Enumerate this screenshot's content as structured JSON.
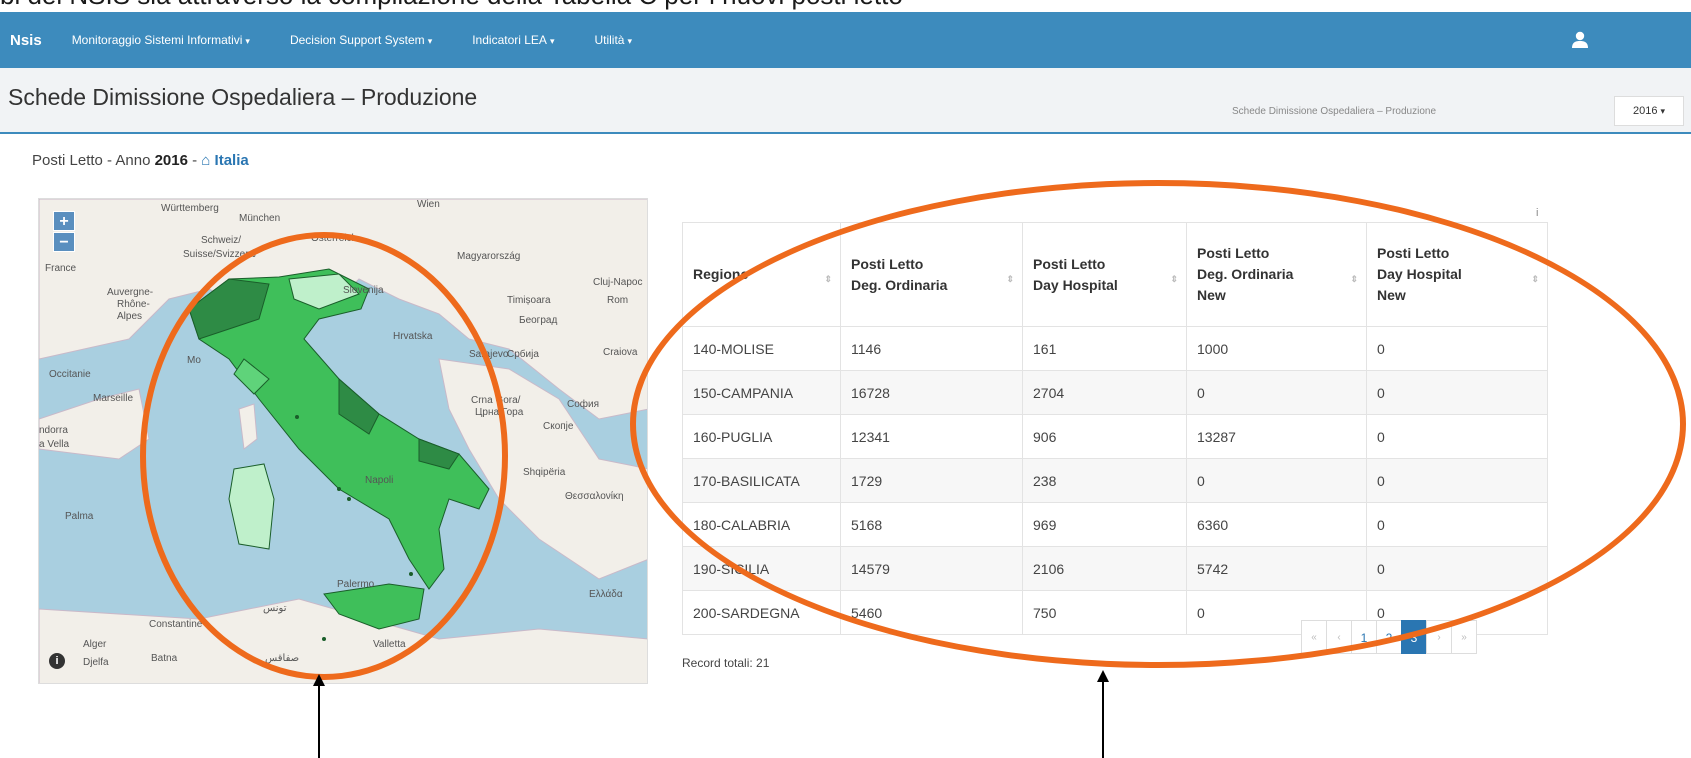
{
  "slide_caption": "bi del NSIS sia attraverso la compilazione della Tabella C per i nuovi posti letto",
  "navbar": {
    "brand": "Nsis",
    "items": [
      {
        "label": "Monitoraggio Sistemi Informativi"
      },
      {
        "label": "Decision Support System"
      },
      {
        "label": "Indicatori LEA"
      },
      {
        "label": "Utilità"
      }
    ],
    "user_icon": "user-icon"
  },
  "header": {
    "title": "Schede Dimissione Ospedaliera – Produzione",
    "breadcrumb": "Schede Dimissione Ospedaliera – Produzione",
    "year_selected": "2016"
  },
  "subheader": {
    "prefix": "Posti Letto - Anno ",
    "year": "2016",
    "separator": " - ",
    "link": "Italia",
    "link_icon": "home-icon"
  },
  "map": {
    "zoom_in": "+",
    "zoom_out": "−",
    "info": "i",
    "labels": {
      "wurttemberg": "Württemberg",
      "munchen": "München",
      "wien": "Wien",
      "schweiz": "Schweiz/",
      "suisse": "Suisse/Svizzera/",
      "france": "France",
      "osterreich": "Österreich",
      "magyarorszag": "Magyarország",
      "cluj": "Cluj-Napoc",
      "auvergne": "Auvergne-",
      "rhone": "Rhône-",
      "alpes": "Alpes",
      "slovenija": "Slovenija",
      "timisoara": "Timișoara",
      "rom": "Rom",
      "beograd": "Београд",
      "hrvatska": "Hrvatska",
      "sarajevo": "Sarajevo",
      "srbija": "Србија",
      "craiova": "Craiova",
      "occitanie": "Occitanie",
      "marseille": "Marseille",
      "monaco": "Mo",
      "crna_gora": "Crna Gora/",
      "crna_gora2": "Црна Гора",
      "sofia": "София",
      "andorra": "ndorra",
      "vella": "a Vella",
      "skopje": "Скопје",
      "shqiperia": "Shqipëria",
      "napoli": "Napoli",
      "thessaloniki": "Θεσσαλονίκη",
      "palma": "Palma",
      "palermo": "Palermo",
      "ellada": "Ελλάδα",
      "alger": "Alger",
      "constantine": "Constantine",
      "valletta": "Valletta",
      "djelfa": "Djelfa",
      "batna": "Batna",
      "tunis": "تونس",
      "sfax": "صفاقس"
    }
  },
  "table": {
    "headers": [
      [
        "Regione"
      ],
      [
        "Posti Letto",
        "Deg. Ordinaria"
      ],
      [
        "Posti Letto",
        "Day Hospital"
      ],
      [
        "Posti Letto",
        "Deg. Ordinaria",
        "New"
      ],
      [
        "Posti Letto",
        "Day Hospital",
        "New"
      ]
    ],
    "rows": [
      [
        "140-MOLISE",
        "1146",
        "161",
        "1000",
        "0"
      ],
      [
        "150-CAMPANIA",
        "16728",
        "2704",
        "0",
        "0"
      ],
      [
        "160-PUGLIA",
        "12341",
        "906",
        "13287",
        "0"
      ],
      [
        "170-BASILICATA",
        "1729",
        "238",
        "0",
        "0"
      ],
      [
        "180-CALABRIA",
        "5168",
        "969",
        "6360",
        "0"
      ],
      [
        "190-SICILIA",
        "14579",
        "2106",
        "5742",
        "0"
      ],
      [
        "200-SARDEGNA",
        "5460",
        "750",
        "0",
        "0"
      ]
    ],
    "info": "i",
    "record_total": "Record totali: 21"
  },
  "pager": {
    "first": "«",
    "prev": "‹",
    "pages": [
      "1",
      "2",
      "3"
    ],
    "active": "3",
    "next": "›",
    "last": "»"
  },
  "colors": {
    "navbar": "#3d8bbd",
    "annotation": "#ee6a1c",
    "link": "#2a76b2",
    "sea": "#a9cfe0",
    "region_green": "#3fbf5a"
  }
}
